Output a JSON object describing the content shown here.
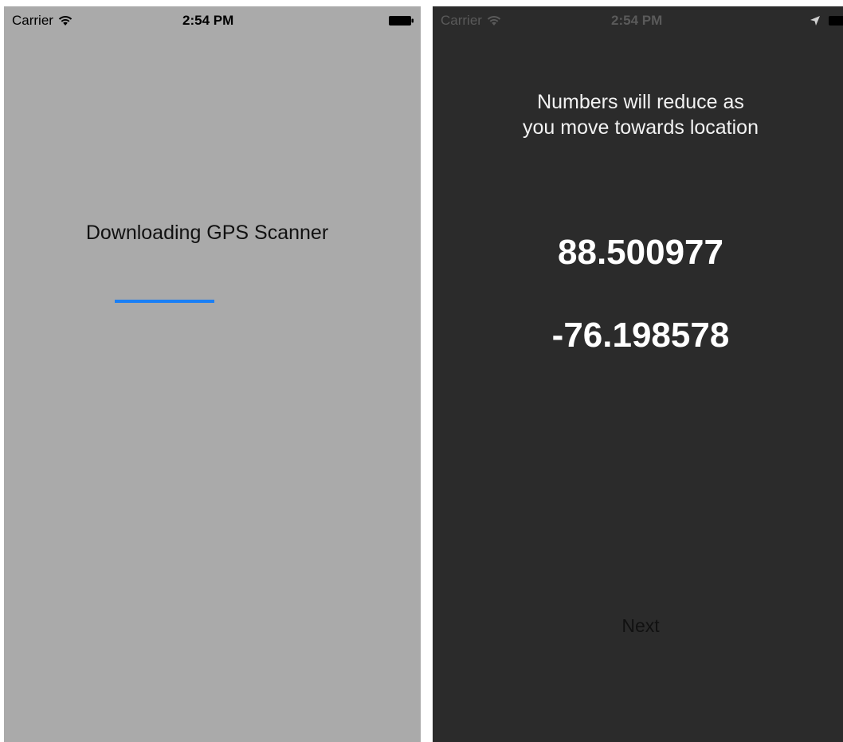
{
  "screens": [
    {
      "status_bar": {
        "carrier": "Carrier",
        "time": "2:54 PM",
        "icons": [
          "wifi-icon",
          "battery-icon"
        ]
      },
      "download_label": "Downloading GPS Scanner",
      "progress": {
        "fraction": 0.5,
        "color": "#1a7ff5"
      },
      "background": "#aaaaaa"
    },
    {
      "status_bar": {
        "carrier": "Carrier",
        "time": "2:54 PM",
        "icons": [
          "wifi-icon",
          "location-arrow-icon",
          "battery-icon"
        ]
      },
      "instruction_line1": "Numbers will reduce as",
      "instruction_line2": "you move towards location",
      "latitude": "88.500977",
      "longitude": "-76.198578",
      "next_label": "Next",
      "background": "#2b2b2b"
    }
  ]
}
